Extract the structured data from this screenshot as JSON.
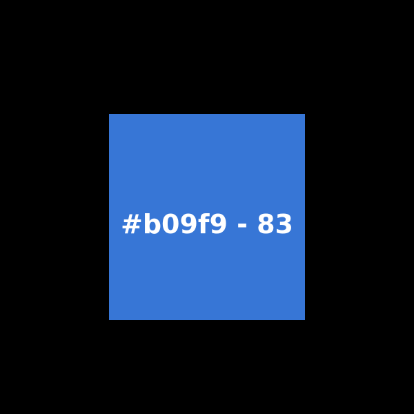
{
  "tile": {
    "label": "#b09f9 - 83",
    "background_color": "#3776d6",
    "text_color": "#ffffff"
  },
  "page": {
    "background_color": "#000000"
  }
}
